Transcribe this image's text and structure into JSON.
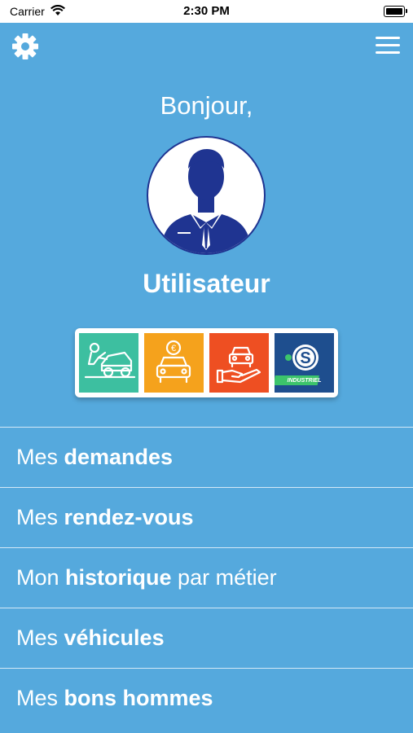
{
  "status_bar": {
    "carrier": "Carrier",
    "time": "2:30 PM"
  },
  "header": {
    "greeting": "Bonjour,",
    "username": "Utilisateur"
  },
  "services": [
    {
      "icon": "mechanic-car-icon",
      "color": "#3dbfa0"
    },
    {
      "icon": "car-euro-icon",
      "color": "#f5a21c"
    },
    {
      "icon": "car-hand-icon",
      "color": "#ee4f22"
    },
    {
      "icon": "s-industriel-logo",
      "color": "#1e4e8e",
      "logo_text": "INDUSTRIEL"
    }
  ],
  "menu_items": [
    {
      "pre": "Mes ",
      "bold": "demandes",
      "post": ""
    },
    {
      "pre": "Mes ",
      "bold": "rendez-vous",
      "post": ""
    },
    {
      "pre": "Mon ",
      "bold": "historique",
      "post": " par métier"
    },
    {
      "pre": "Mes ",
      "bold": "véhicules",
      "post": ""
    },
    {
      "pre": "Mes ",
      "bold": "bons hommes",
      "post": ""
    }
  ],
  "colors": {
    "background": "#55a9dd",
    "avatar_blue": "#1f3491"
  }
}
